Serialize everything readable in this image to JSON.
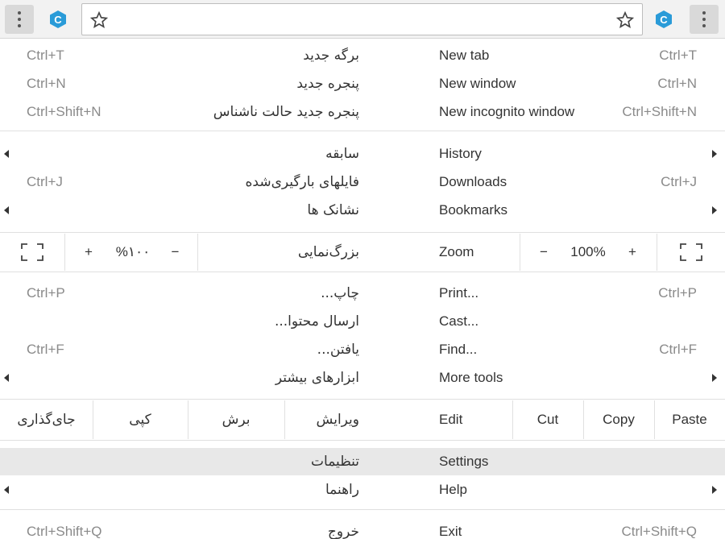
{
  "colors": {
    "toolbar_bg": "#f2f2f2",
    "ext_blue": "#2a9bd8",
    "highlight": "#e8e8e8",
    "shortcut_gray": "#8a8a8a"
  },
  "toolbar": {
    "left_menu_icon": "kebab-menu-icon",
    "left_ext_icon": "extension-c-icon",
    "right_ext_icon": "extension-c-icon",
    "right_menu_icon": "kebab-menu-icon",
    "left_star_icon": "star-icon",
    "right_star_icon": "star-icon",
    "ext_letter": "C"
  },
  "fa_menu": {
    "new_tab": {
      "label": "برگه جدید",
      "shortcut": "Ctrl+T"
    },
    "new_window": {
      "label": "پنجره جدید",
      "shortcut": "Ctrl+N"
    },
    "new_incognito": {
      "label": "پنجره جدید حالت ناشناس",
      "shortcut": "Ctrl+Shift+N"
    },
    "history": {
      "label": "سابقه"
    },
    "downloads": {
      "label": "فایلهای بارگیری‌شده",
      "shortcut": "Ctrl+J"
    },
    "bookmarks": {
      "label": "نشانک ها"
    },
    "zoom": {
      "label": "بزرگ‌نمایی",
      "value": "%۱۰۰",
      "minus": "−",
      "plus": "+"
    },
    "print": {
      "label": "چاپ...",
      "shortcut": "Ctrl+P"
    },
    "cast": {
      "label": "ارسال محتوا..."
    },
    "find": {
      "label": "یافتن...",
      "shortcut": "Ctrl+F"
    },
    "more_tools": {
      "label": "ابزارهای بیشتر"
    },
    "edit": {
      "label": "ویرایش",
      "cut": "برش",
      "copy": "کپی",
      "paste": "جای‌گذاری"
    },
    "settings": {
      "label": "تنظیمات"
    },
    "help": {
      "label": "راهنما"
    },
    "exit": {
      "label": "خروج",
      "shortcut": "Ctrl+Shift+Q"
    }
  },
  "en_menu": {
    "new_tab": {
      "label": "New tab",
      "shortcut": "Ctrl+T"
    },
    "new_window": {
      "label": "New window",
      "shortcut": "Ctrl+N"
    },
    "new_incognito": {
      "label": "New incognito window",
      "shortcut": "Ctrl+Shift+N"
    },
    "history": {
      "label": "History"
    },
    "downloads": {
      "label": "Downloads",
      "shortcut": "Ctrl+J"
    },
    "bookmarks": {
      "label": "Bookmarks"
    },
    "zoom": {
      "label": "Zoom",
      "value": "100%",
      "minus": "−",
      "plus": "+"
    },
    "print": {
      "label": "Print...",
      "shortcut": "Ctrl+P"
    },
    "cast": {
      "label": "Cast..."
    },
    "find": {
      "label": "Find...",
      "shortcut": "Ctrl+F"
    },
    "more_tools": {
      "label": "More tools"
    },
    "edit": {
      "label": "Edit",
      "cut": "Cut",
      "copy": "Copy",
      "paste": "Paste"
    },
    "settings": {
      "label": "Settings"
    },
    "help": {
      "label": "Help"
    },
    "exit": {
      "label": "Exit",
      "shortcut": "Ctrl+Shift+Q"
    }
  }
}
